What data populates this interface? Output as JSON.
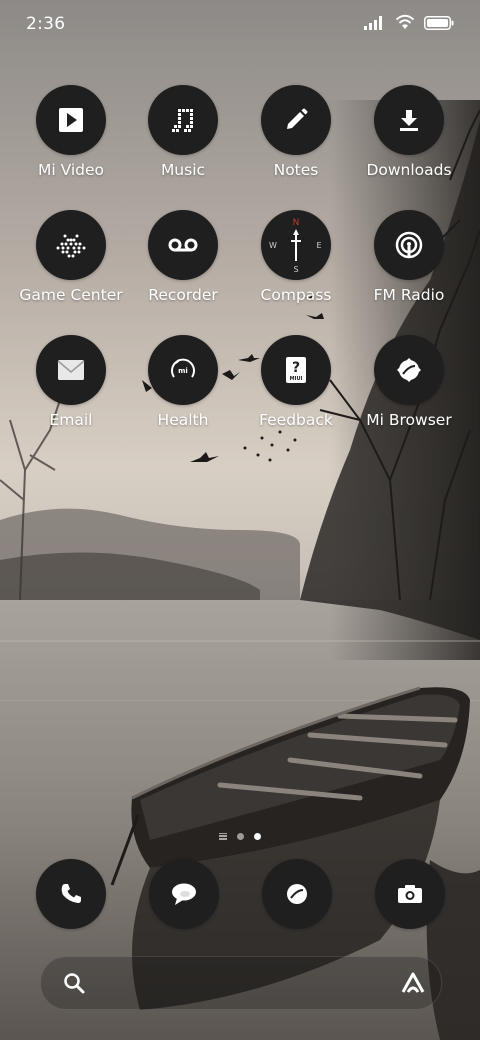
{
  "status_bar": {
    "time": "2:36",
    "icons": [
      "signal-icon",
      "wifi-icon",
      "battery-icon"
    ]
  },
  "apps": [
    {
      "label": "Mi Video",
      "icon": "play-icon"
    },
    {
      "label": "Music",
      "icon": "music-note-icon"
    },
    {
      "label": "Notes",
      "icon": "pencil-icon"
    },
    {
      "label": "Downloads",
      "icon": "download-icon"
    },
    {
      "label": "Game Center",
      "icon": "game-invader-icon"
    },
    {
      "label": "Recorder",
      "icon": "voicemail-icon"
    },
    {
      "label": "Compass",
      "icon": "compass-icon"
    },
    {
      "label": "FM Radio",
      "icon": "radio-broadcast-icon"
    },
    {
      "label": "Email",
      "icon": "envelope-icon"
    },
    {
      "label": "Health",
      "icon": "mi-health-icon"
    },
    {
      "label": "Feedback",
      "icon": "miui-question-icon"
    },
    {
      "label": "Mi Browser",
      "icon": "browser-icon"
    }
  ],
  "icon_text": {
    "compass_n": "N",
    "compass_e": "E",
    "compass_s": "S",
    "compass_w": "W",
    "health_mi": "mi",
    "feedback_q": "?",
    "feedback_miui": "MIUI"
  },
  "page_indicator": {
    "pages": 2,
    "active": 2
  },
  "dock": [
    {
      "icon": "phone-icon"
    },
    {
      "icon": "messages-icon"
    },
    {
      "icon": "browser-icon"
    },
    {
      "icon": "camera-icon"
    }
  ],
  "search": {
    "placeholder": "",
    "icon": "search-icon",
    "assistant_icon": "assistant-icon"
  },
  "colors": {
    "icon_bg": "#1f1f1f",
    "compass_north": "#c0392b"
  }
}
